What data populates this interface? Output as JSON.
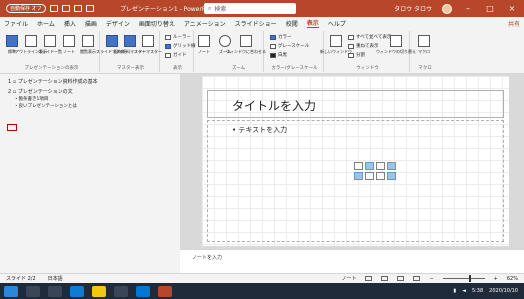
{
  "titlebar": {
    "autosave": "自動保存 オフ",
    "title": "プレゼンテーション1 - PowerPoint",
    "search_placeholder": "検索",
    "user": "タロウ タロウ",
    "min": "–",
    "restore": "□",
    "close": "×"
  },
  "tabs": [
    "ファイル",
    "ホーム",
    "挿入",
    "描画",
    "デザイン",
    "画面切り替え",
    "アニメーション",
    "スライドショー",
    "校閲",
    "表示",
    "ヘルプ"
  ],
  "active_tab": "表示",
  "share_label": "共有",
  "ribbon": {
    "groups": [
      {
        "caption": "プレゼンテーションの表示",
        "buttons": [
          "標準",
          "アウトライン表示",
          "スライド一覧",
          "ノート",
          "閲覧表示"
        ]
      },
      {
        "caption": "マスター表示",
        "buttons": [
          "スライドマスター",
          "配布資料マスター",
          "ノートマスター"
        ]
      },
      {
        "caption": "表示",
        "items": [
          "ルーラー",
          "グリッド線",
          "ガイド"
        ]
      },
      {
        "caption": "ズーム",
        "buttons": [
          "ズーム",
          "ウィンドウに合わせる"
        ]
      },
      {
        "caption": "カラー/グレースケール",
        "items": [
          "カラー",
          "グレースケール",
          "白黒"
        ]
      },
      {
        "caption": "ウィンドウ",
        "buttons": [
          "新しいウィンドウ"
        ],
        "items": [
          "すべて並べて表示",
          "重ねて表示",
          "分割",
          "ウィンドウの切り替え"
        ]
      },
      {
        "caption": "マクロ",
        "buttons": [
          "マクロ"
        ]
      }
    ],
    "extra_button": "ノート"
  },
  "outline": {
    "items": [
      {
        "title": "プレゼンテーション資料作成の基本",
        "subs": []
      },
      {
        "title": "プレゼンテーションの文",
        "subs": [
          "・箇条書き1項目",
          "・良いプレゼンテーションとは"
        ]
      }
    ]
  },
  "slide": {
    "title_placeholder": "タイトルを入力",
    "content_placeholder": "• テキストを入力"
  },
  "notes_placeholder": "ノートを入力",
  "statusbar": {
    "slide_info": "スライド 2/2",
    "language": "日本語",
    "notes_btn": "ノート",
    "zoom_minus": "−",
    "zoom_plus": "+",
    "zoom_level": "62%"
  },
  "taskbar": {
    "apps": [
      "windows",
      "search",
      "task-view",
      "edge",
      "explorer",
      "store",
      "mail",
      "powerpoint"
    ],
    "time": "5:38",
    "date": "2020/10/10"
  },
  "colors": {
    "brand": "#b7472a",
    "taskbar": "#1f2a3a"
  }
}
